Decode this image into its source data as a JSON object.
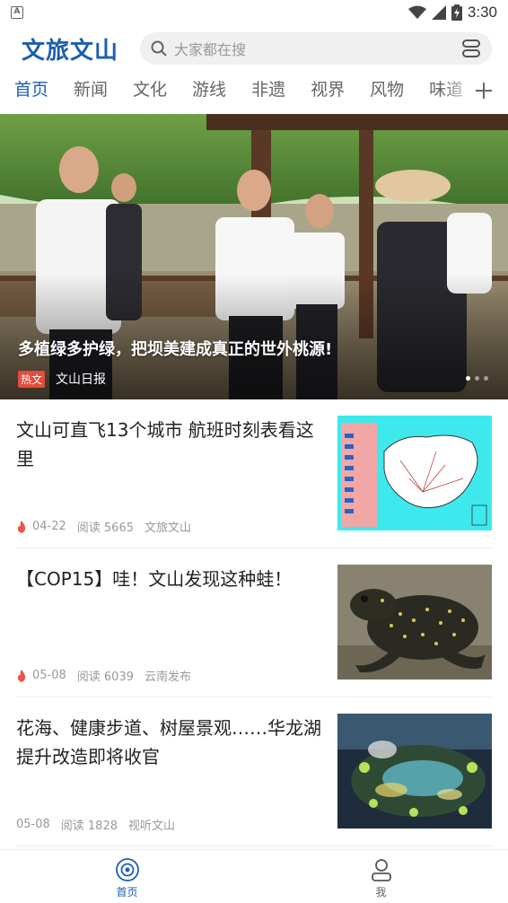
{
  "status": {
    "time": "3:30",
    "app_indicator": "A",
    "icons": [
      "wifi-icon",
      "signal-icon",
      "battery-icon"
    ]
  },
  "header": {
    "logo": "文旅文山",
    "search_placeholder": "大家都在搜",
    "icons": [
      "search-icon",
      "scan-icon"
    ]
  },
  "tabs": [
    {
      "label": "首页",
      "active": true
    },
    {
      "label": "新闻",
      "active": false
    },
    {
      "label": "文化",
      "active": false
    },
    {
      "label": "游线",
      "active": false
    },
    {
      "label": "非遗",
      "active": false
    },
    {
      "label": "视界",
      "active": false
    },
    {
      "label": "风物",
      "active": false
    },
    {
      "label": "味道",
      "active": false
    }
  ],
  "hero": {
    "title": "多植绿多护绿，把坝美建成真正的世外桃源!",
    "badge": "热文",
    "source": "文山日报",
    "slides": 3,
    "active_slide": 1
  },
  "news": [
    {
      "title": "文山可直飞13个城市 航班时刻表看这里",
      "hot": true,
      "date": "04-22",
      "reads": "阅读 5665",
      "source": "文旅文山",
      "thumb": "map-image"
    },
    {
      "title": "【COP15】哇！文山发现这种蛙！",
      "hot": true,
      "date": "05-08",
      "reads": "阅读 6039",
      "source": "云南发布",
      "thumb": "frog-image"
    },
    {
      "title": "花海、健康步道、树屋景观……华龙湖提升改造即将收官",
      "hot": false,
      "date": "05-08",
      "reads": "阅读 1828",
      "source": "视听文山",
      "thumb": "park-image"
    }
  ],
  "bottom_nav": [
    {
      "label": "首页",
      "icon": "home-icon",
      "active": true
    },
    {
      "label": "我",
      "icon": "user-icon",
      "active": false
    }
  ],
  "colors": {
    "brand": "#1b5fad",
    "hot": "#e54b3c"
  }
}
